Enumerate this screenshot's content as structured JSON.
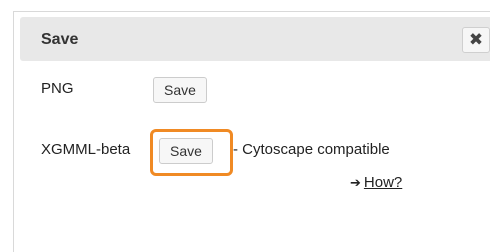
{
  "dialog": {
    "title": "Save",
    "close_label": "✖"
  },
  "rows": [
    {
      "label": "PNG",
      "button": "Save"
    },
    {
      "label": "XGMML-beta",
      "button": "Save",
      "suffix": "- Cytoscape compatible"
    }
  ],
  "help": {
    "arrow": "➔",
    "label": "How?"
  },
  "colors": {
    "highlight": "#f08a24",
    "title_bar": "#e8e8e8"
  }
}
